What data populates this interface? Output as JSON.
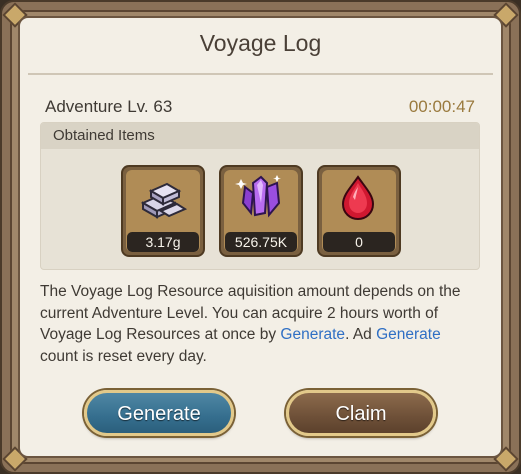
{
  "dialog": {
    "title": "Voyage Log",
    "adventure_level": "Adventure Lv. 63",
    "timer": "00:00:47",
    "obtained_items_header": "Obtained Items"
  },
  "items": [
    {
      "icon": "silver-bars-icon",
      "count": "3.17g"
    },
    {
      "icon": "purple-crystal-icon",
      "count": "526.75K"
    },
    {
      "icon": "red-gem-icon",
      "count": "0"
    }
  ],
  "description": {
    "part1": "The Voyage Log Resource aquisition amount depends on the current Adventure Level. You can acquire 2 hours worth of Voyage Log Resources at once by ",
    "link1": "Generate",
    "part2": ". Ad ",
    "link2": "Generate",
    "part3": " count is reset every day."
  },
  "buttons": {
    "generate": "Generate",
    "claim": "Claim"
  },
  "colors": {
    "panel_bg": "#f3efe6",
    "frame": "#8a7158",
    "timer": "#9a7a3e",
    "link": "#2f6fc4",
    "generate_button": "#356e8e",
    "claim_button": "#6e5038"
  }
}
